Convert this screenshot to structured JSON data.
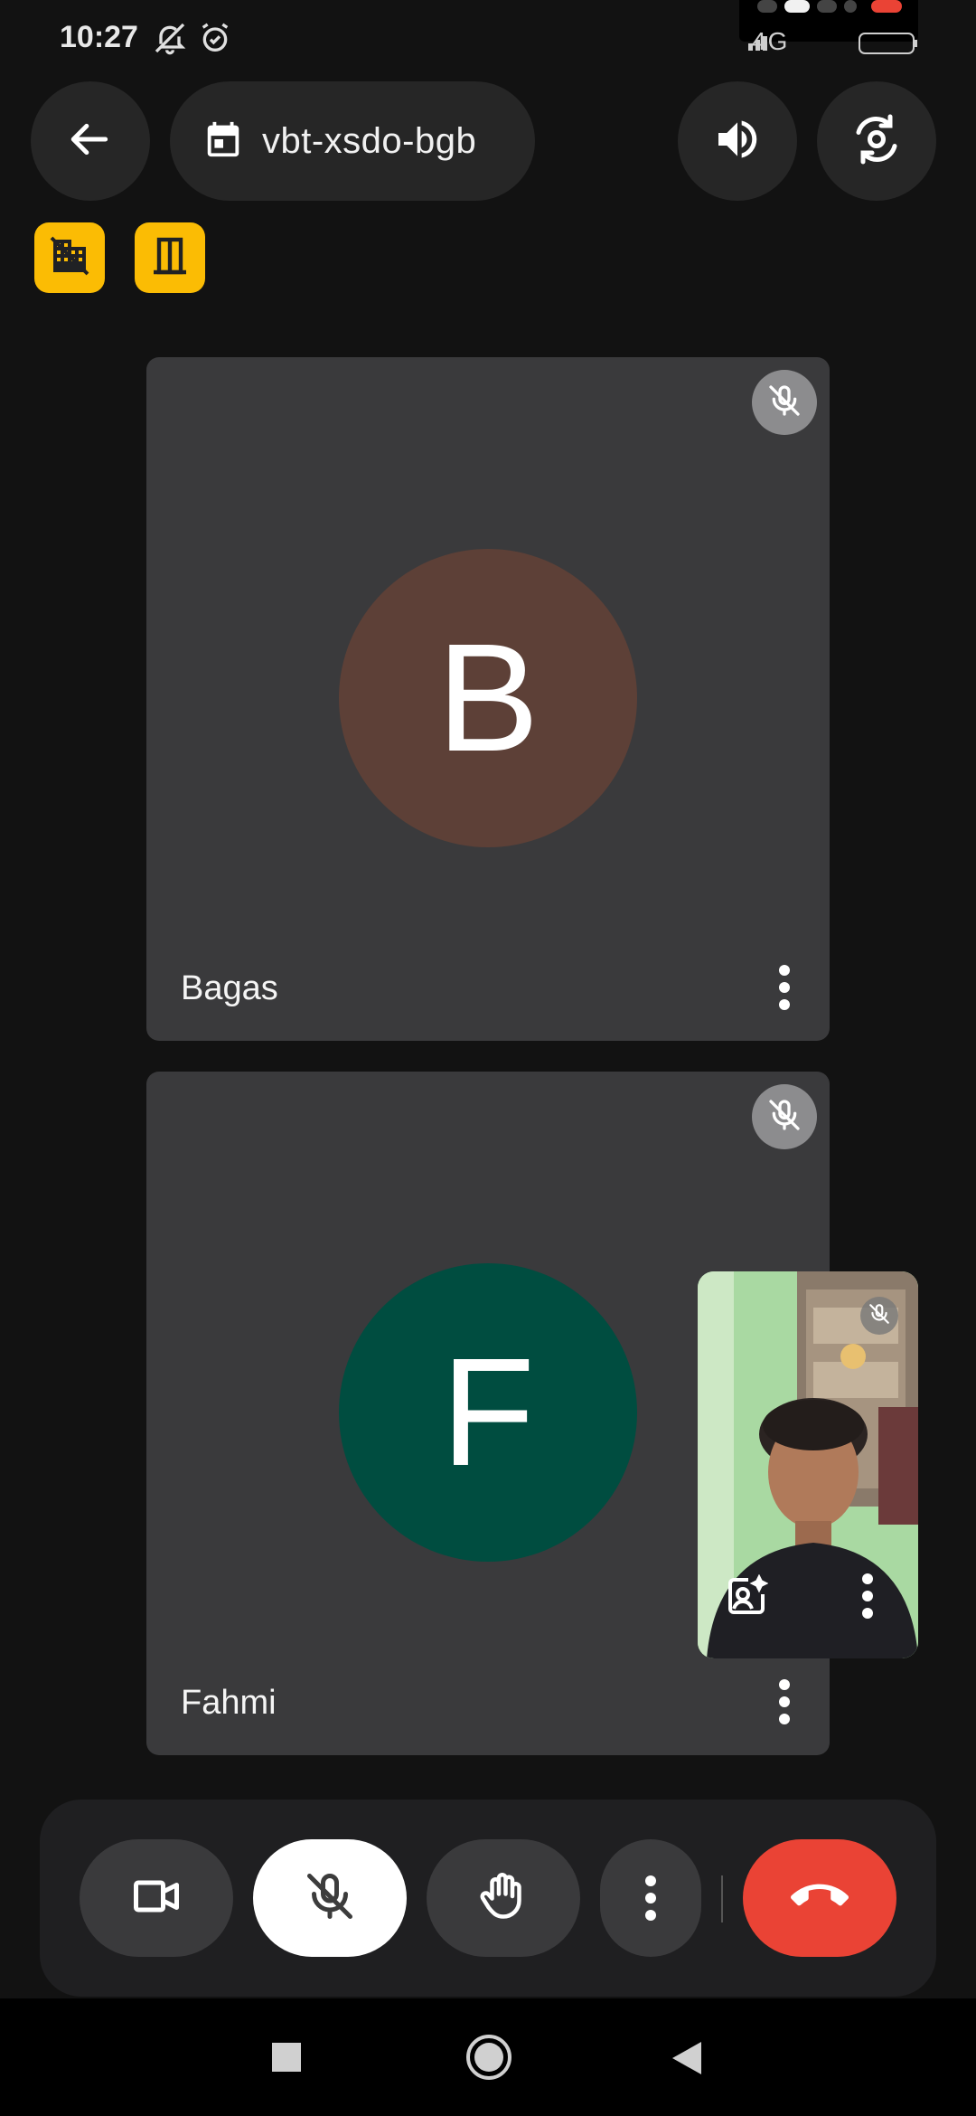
{
  "status_bar": {
    "time": "10:27",
    "network": "4G",
    "icons": [
      "notifications-off-icon",
      "alarm-icon",
      "signal-icon",
      "battery-icon"
    ]
  },
  "top_bar": {
    "back_icon": "arrow-back-icon",
    "meeting_code": "vbt-xsdo-bgb",
    "calendar_icon": "calendar-icon",
    "speaker_icon": "volume-icon",
    "switch_camera_icon": "switch-camera-icon"
  },
  "badges": [
    {
      "icon": "domain-disabled-icon",
      "color": "#fbbc04"
    },
    {
      "icon": "door-icon",
      "color": "#fbbc04"
    }
  ],
  "participants": [
    {
      "name": "Bagas",
      "initial": "B",
      "avatar_color": "#5d4037",
      "muted": true
    },
    {
      "name": "Fahmi",
      "initial": "F",
      "avatar_color": "#004d40",
      "muted": true
    }
  ],
  "self_view": {
    "muted": true,
    "effects_icon": "effects-icon",
    "menu_icon": "more-vert-icon"
  },
  "controls": [
    {
      "name": "camera",
      "icon": "videocam-icon"
    },
    {
      "name": "microphone",
      "icon": "mic-off-icon",
      "state": "off"
    },
    {
      "name": "raise-hand",
      "icon": "hand-icon"
    },
    {
      "name": "more",
      "icon": "more-vert-icon"
    },
    {
      "name": "end-call",
      "icon": "call-end-icon",
      "color": "#ea4335"
    }
  ],
  "nav_bar": [
    "recents-icon",
    "home-icon",
    "back-icon"
  ]
}
